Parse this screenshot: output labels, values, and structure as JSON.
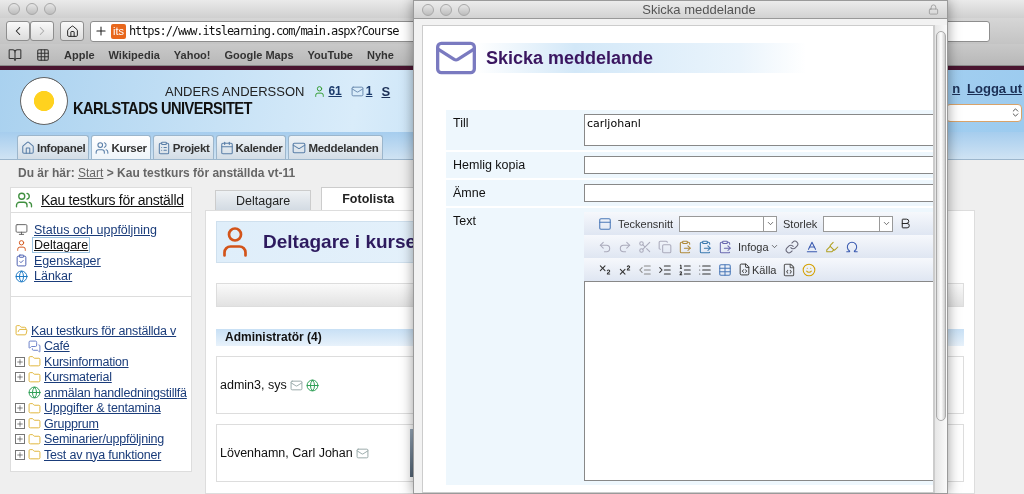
{
  "browser": {
    "url": "https://www.itslearning.com/main.aspx?Course",
    "site_badge": "its",
    "bookmarks": [
      "Apple",
      "Wikipedia",
      "Yahoo!",
      "Google Maps",
      "YouTube",
      "Nyhe"
    ]
  },
  "site": {
    "user": "ANDERS ANDERSSON",
    "university": "KARLSTADS UNIVERSITET",
    "counters": [
      {
        "kind": "people",
        "label": "61"
      },
      {
        "kind": "messages",
        "label": "1"
      }
    ],
    "cut_link": "S",
    "right_links": [
      "n",
      "Logga ut"
    ],
    "nav_tabs": [
      {
        "label": "Infopanel",
        "kind": "home",
        "selected": false
      },
      {
        "label": "Kurser",
        "kind": "courses",
        "selected": true
      },
      {
        "label": "Projekt",
        "kind": "projects",
        "selected": false
      },
      {
        "label": "Kalender",
        "kind": "calendar",
        "selected": false
      },
      {
        "label": "Meddelanden",
        "kind": "messages",
        "selected": false
      }
    ]
  },
  "breadcrumb": {
    "prefix": "Du är här:",
    "link": "Start",
    "rest": "> Kau testkurs för anställda vt-11"
  },
  "sidebar": {
    "course_title": "Kau testkurs för anställd",
    "menu": [
      {
        "label": "Status och uppföljning",
        "kind": "status",
        "selected": false
      },
      {
        "label": "Deltagare",
        "kind": "participants",
        "selected": true
      },
      {
        "label": "Egenskaper",
        "kind": "properties",
        "selected": false
      },
      {
        "label": "Länkar",
        "kind": "links",
        "selected": false
      }
    ],
    "tree": {
      "label": "Kau testkurs för anställda v",
      "children": [
        {
          "label": "Café",
          "kind": "cafe"
        },
        {
          "label": "Kursinformation",
          "kind": "folder",
          "expanded": false
        },
        {
          "label": "Kursmaterial",
          "kind": "folder",
          "expanded": false
        },
        {
          "label": "anmälan handledningstillfä",
          "kind": "web"
        },
        {
          "label": "Uppgifter & tentamina",
          "kind": "folder",
          "expanded": false
        },
        {
          "label": "Grupprum",
          "kind": "folder",
          "expanded": false
        },
        {
          "label": "Seminarier/uppföljning",
          "kind": "folder",
          "expanded": false
        },
        {
          "label": "Test av nya funktioner",
          "kind": "folder",
          "expanded": false
        }
      ]
    }
  },
  "content": {
    "tabs": [
      {
        "label": "Deltagare",
        "selected": false
      },
      {
        "label": "Fotolista",
        "selected": true
      }
    ],
    "heading": "Deltagare i kurse",
    "group": "Administratör (4)",
    "people": [
      {
        "name": "admin3, sys",
        "web": true,
        "photo": false
      },
      {
        "name": "Lövenhamn, Carl Johan",
        "web": false,
        "photo": true
      }
    ]
  },
  "dialog": {
    "window_title": "Skicka meddelande",
    "heading": "Skicka meddelande",
    "fields": [
      {
        "label": "Till",
        "value": "carljohanl",
        "kind": "tall"
      },
      {
        "label": "Hemlig kopia",
        "kind": "line"
      },
      {
        "label": "Ämne",
        "kind": "line"
      }
    ],
    "text_label": "Text",
    "font_label": "Teckensnitt",
    "size_label": "Storlek",
    "insert_label": "Infoga",
    "source_label": "Källa"
  }
}
